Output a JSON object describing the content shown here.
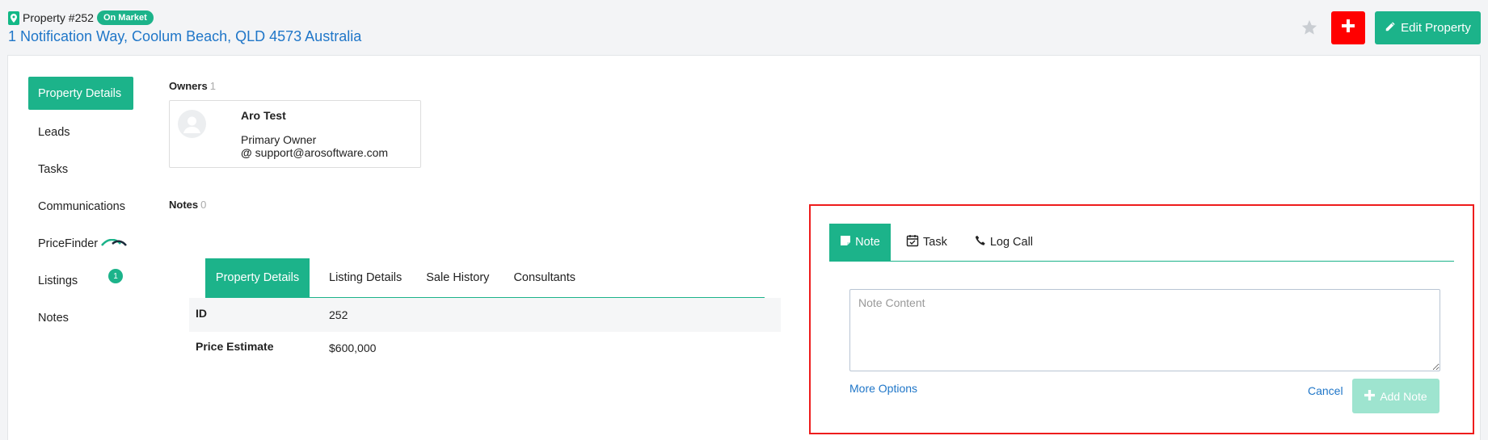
{
  "header": {
    "property_number": "Property #252",
    "status_badge": "On Market",
    "address": "1 Notification Way, Coolum Beach, QLD 4573 Australia",
    "edit_label": "Edit Property"
  },
  "colors": {
    "accent": "#1cb38a",
    "link": "#1f76c8",
    "danger": "#ff0000",
    "highlight_border": "#ee1c1c"
  },
  "sidebar": {
    "items": [
      {
        "label": "Property Details",
        "active": true
      },
      {
        "label": "Leads"
      },
      {
        "label": "Tasks"
      },
      {
        "label": "Communications"
      },
      {
        "label": "PriceFinder"
      },
      {
        "label": "Listings",
        "badge": "1"
      },
      {
        "label": "Notes"
      }
    ]
  },
  "owners": {
    "label": "Owners",
    "count": "1",
    "list": [
      {
        "name": "Aro Test",
        "role": "Primary Owner",
        "email": "support@arosoftware.com"
      }
    ]
  },
  "notes": {
    "label": "Notes",
    "count": "0"
  },
  "property_tabs": [
    {
      "label": "Property Details",
      "active": true
    },
    {
      "label": "Listing Details"
    },
    {
      "label": "Sale History"
    },
    {
      "label": "Consultants"
    }
  ],
  "details": [
    {
      "key": "ID",
      "value": "252"
    },
    {
      "key": "Price Estimate",
      "value": "$600,000"
    }
  ],
  "note_panel": {
    "tabs": [
      {
        "label": "Note",
        "icon": "note-icon",
        "active": true
      },
      {
        "label": "Task",
        "icon": "calendar-check-icon"
      },
      {
        "label": "Log Call",
        "icon": "phone-icon"
      }
    ],
    "placeholder": "Note Content",
    "more_options": "More Options",
    "cancel": "Cancel",
    "add_note": "Add Note"
  }
}
